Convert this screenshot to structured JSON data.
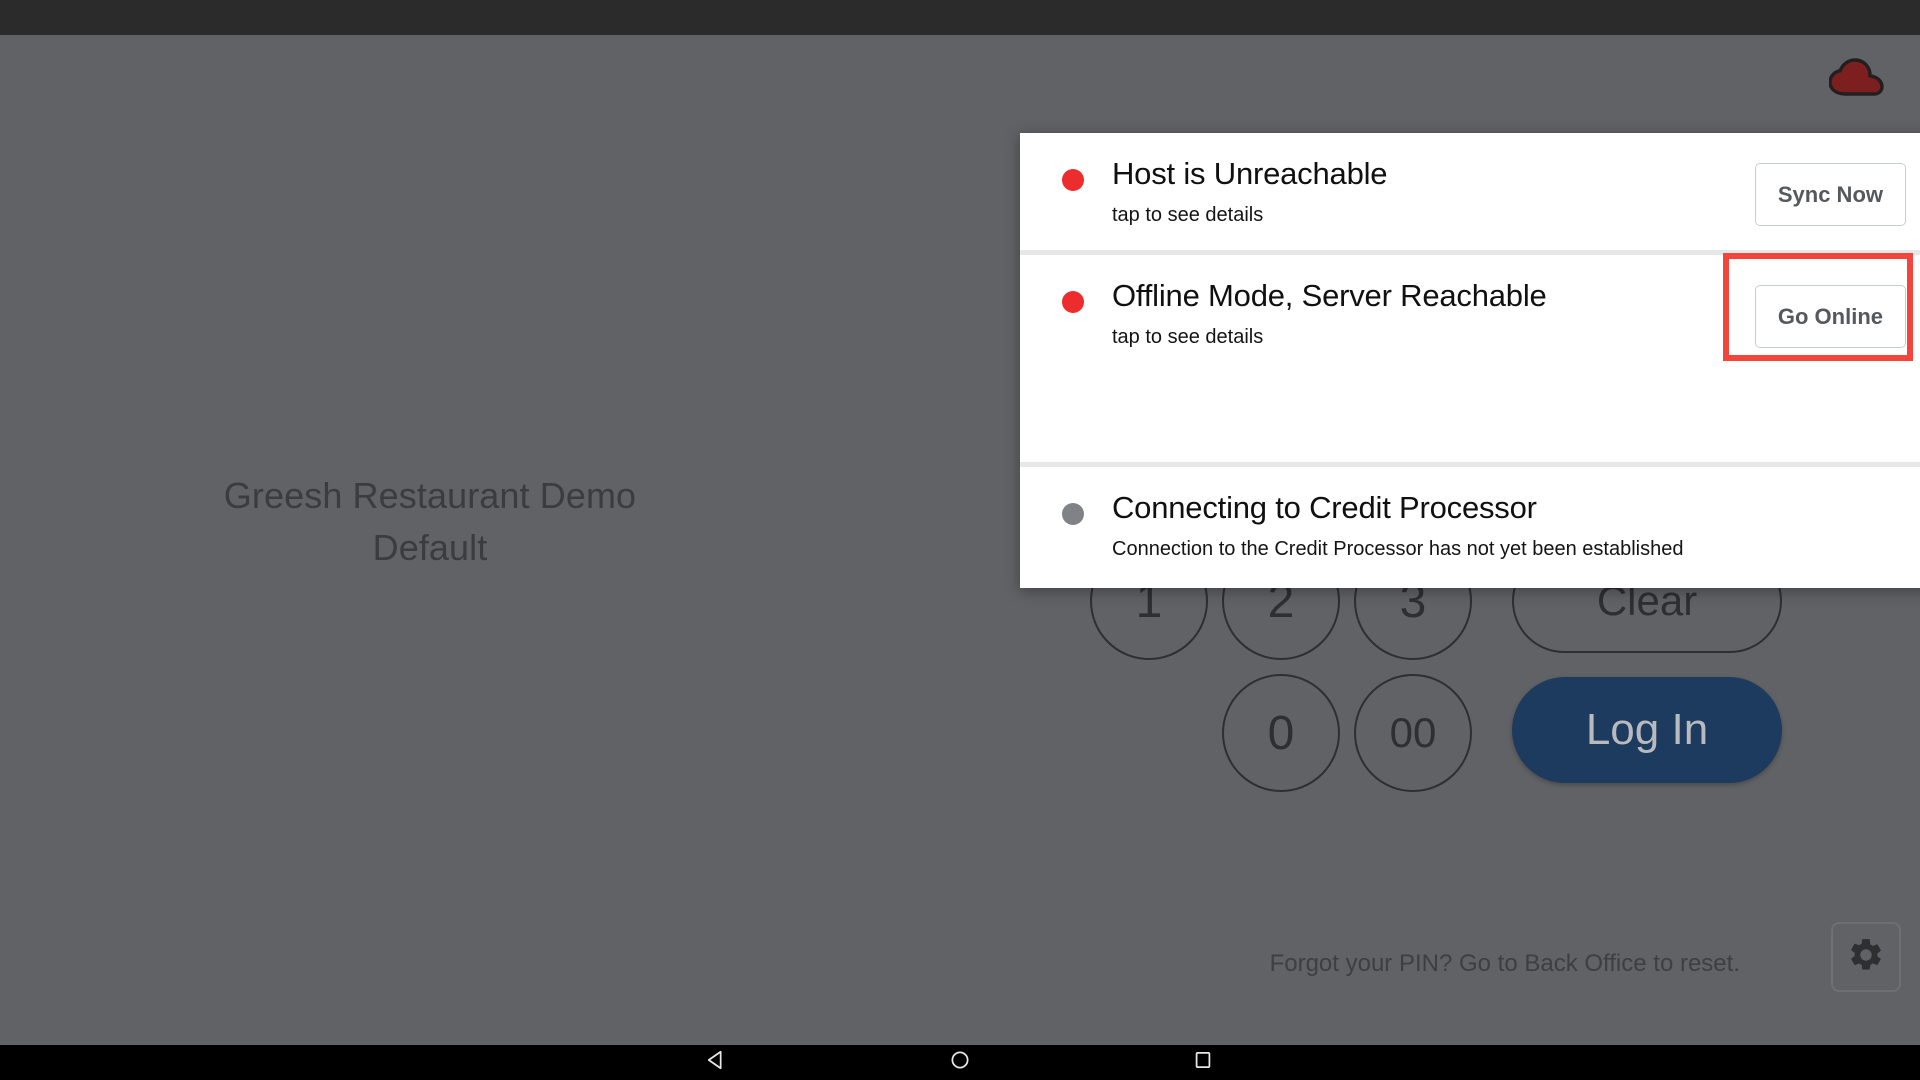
{
  "window": {
    "platform": "android-tablet",
    "status_bar_color": "#2b2b2b",
    "scrim_color": "#616265"
  },
  "header": {
    "cloud_icon": "cloud-status-icon",
    "cloud_icon_color": "#7d1f1f"
  },
  "venue": {
    "name": "Greesh Restaurant Demo",
    "revenue_center": "Default"
  },
  "login": {
    "keypad": [
      {
        "label": "1",
        "name": "key-1"
      },
      {
        "label": "2",
        "name": "key-2"
      },
      {
        "label": "3",
        "name": "key-3"
      },
      {
        "label": "0",
        "name": "key-0"
      },
      {
        "label": "00",
        "name": "key-00"
      }
    ],
    "clear_label": "Clear",
    "login_label": "Log In",
    "login_color": "#1d3a5f",
    "pin_hint": "Forgot your PIN? Go to Back Office to reset.",
    "settings_icon": "gear-icon"
  },
  "status_panel": {
    "rows": [
      {
        "title": "Host is Unreachable",
        "subtitle": "tap to see details",
        "dot": "red",
        "dot_color": "#ed2d2d",
        "action_label": "Sync Now",
        "action_name": "sync-now-button",
        "highlighted": false
      },
      {
        "title": "Offline Mode, Server Reachable",
        "subtitle": "tap to see details",
        "dot": "red",
        "dot_color": "#ed2d2d",
        "action_label": "Go Online",
        "action_name": "go-online-button",
        "highlighted": true
      },
      {
        "title": "Connecting to Credit Processor",
        "subtitle": "Connection to the Credit Processor has not yet been established",
        "dot": "grey",
        "dot_color": "#808285",
        "action_label": "",
        "action_name": "",
        "highlighted": false
      }
    ],
    "highlight_color": "#f4453d"
  },
  "navbar": {
    "back": "back-triangle-icon",
    "home": "home-circle-icon",
    "recents": "recents-square-icon"
  }
}
